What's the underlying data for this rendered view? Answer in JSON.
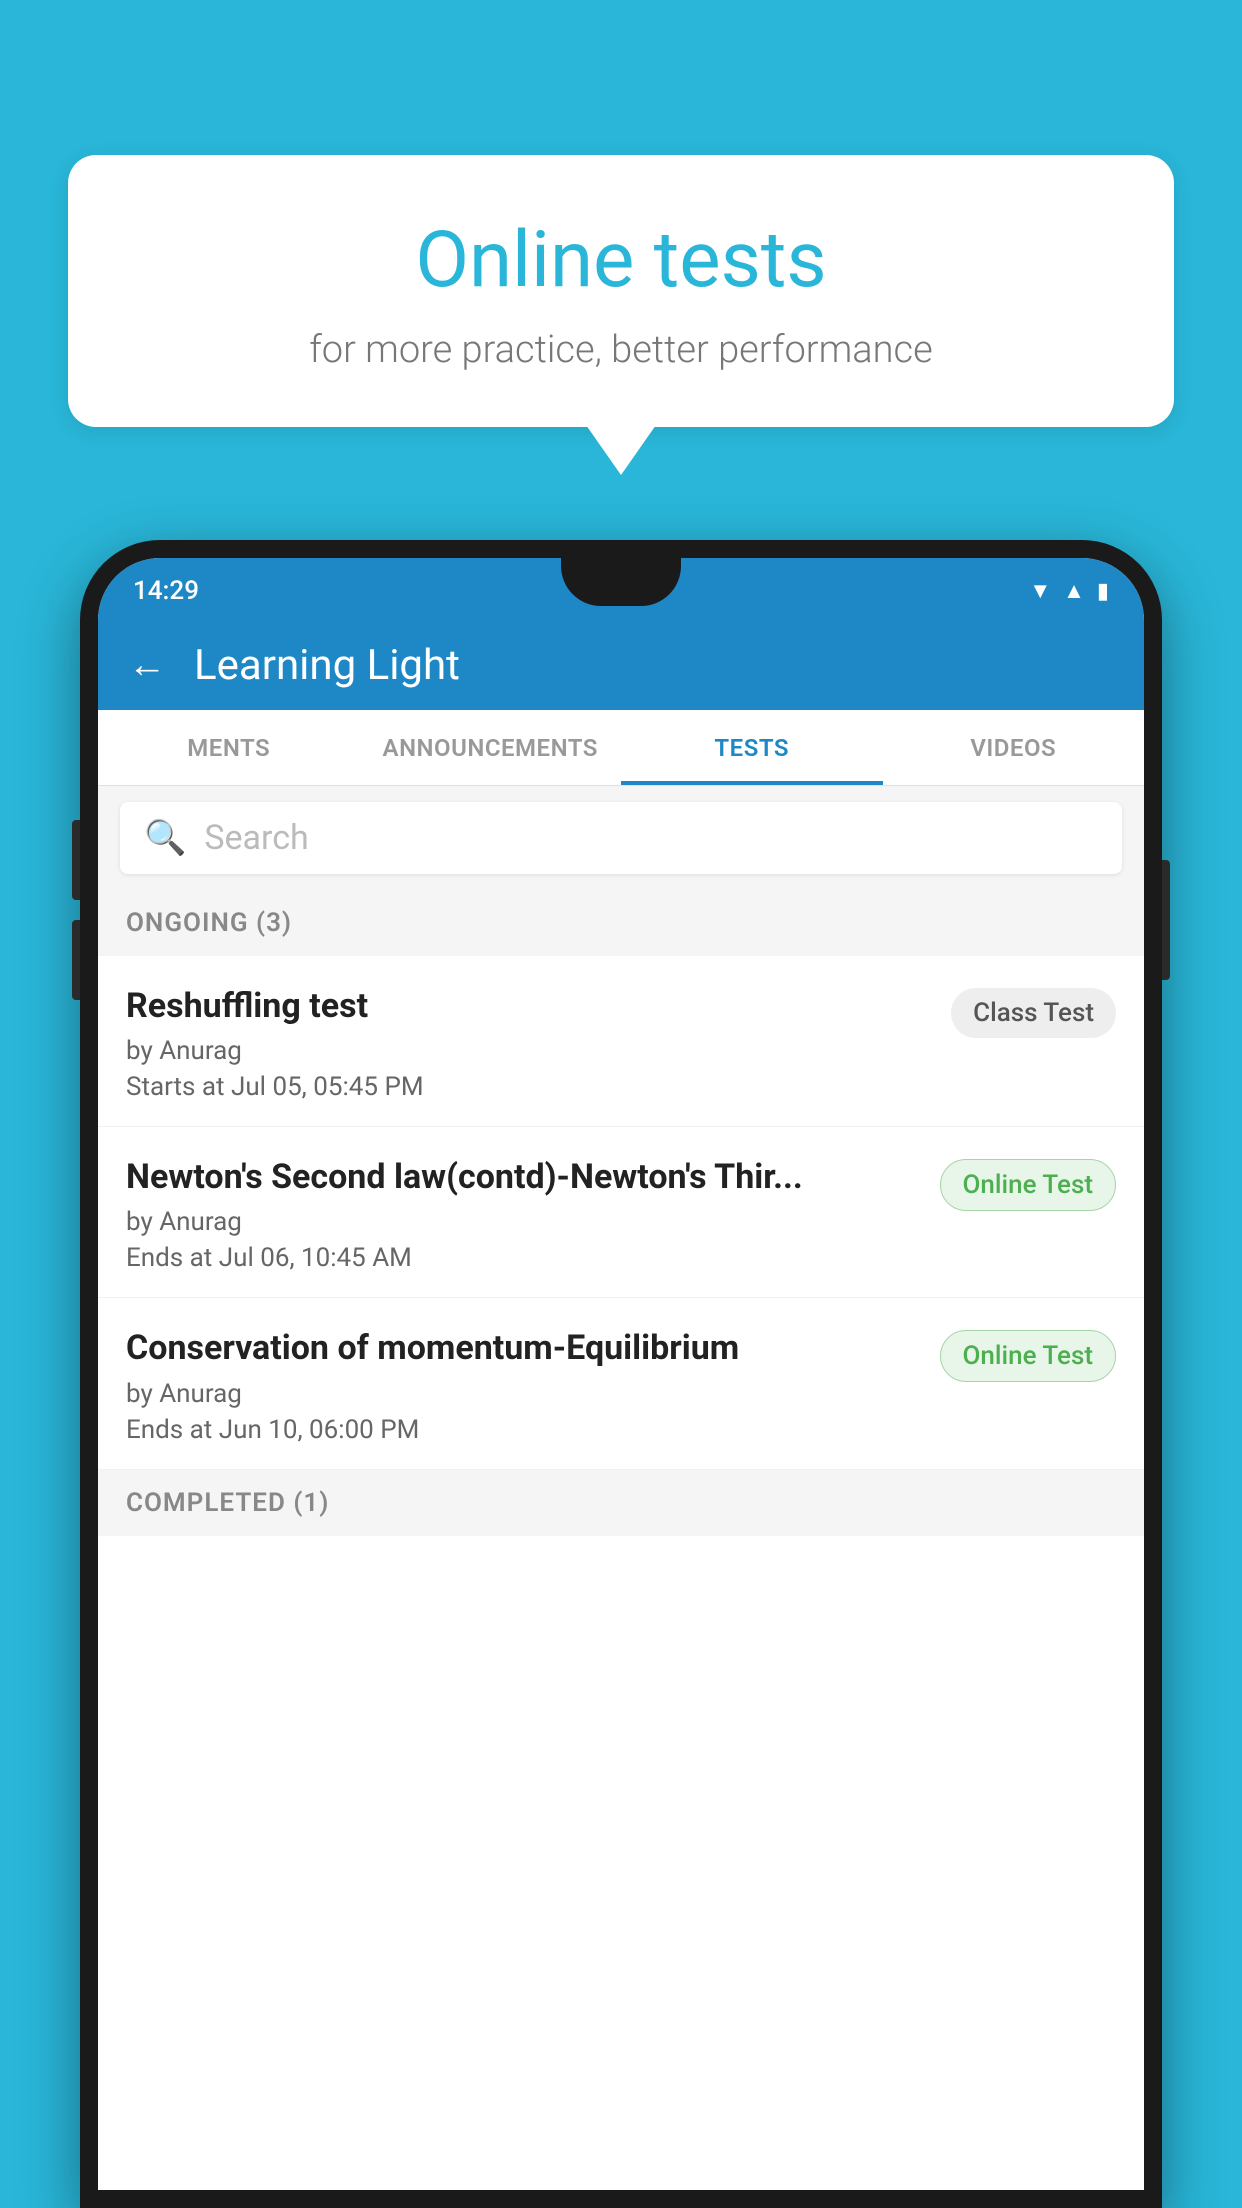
{
  "background": {
    "color": "#29b6d8"
  },
  "bubble": {
    "title": "Online tests",
    "subtitle": "for more practice, better performance"
  },
  "phone": {
    "status_bar": {
      "time": "14:29",
      "wifi_icon": "▼",
      "signal_icon": "▲",
      "battery_icon": "▮"
    },
    "app_bar": {
      "back_label": "←",
      "title": "Learning Light"
    },
    "tabs": [
      {
        "label": "MENTS",
        "active": false
      },
      {
        "label": "ANNOUNCEMENTS",
        "active": false
      },
      {
        "label": "TESTS",
        "active": true
      },
      {
        "label": "VIDEOS",
        "active": false
      }
    ],
    "search": {
      "placeholder": "Search"
    },
    "ongoing_section": {
      "label": "ONGOING (3)"
    },
    "tests": [
      {
        "name": "Reshuffling test",
        "author": "by Anurag",
        "date": "Starts at  Jul 05, 05:45 PM",
        "badge": "Class Test",
        "badge_type": "class"
      },
      {
        "name": "Newton's Second law(contd)-Newton's Thir...",
        "author": "by Anurag",
        "date": "Ends at  Jul 06, 10:45 AM",
        "badge": "Online Test",
        "badge_type": "online"
      },
      {
        "name": "Conservation of momentum-Equilibrium",
        "author": "by Anurag",
        "date": "Ends at  Jun 10, 06:00 PM",
        "badge": "Online Test",
        "badge_type": "online"
      }
    ],
    "completed_section": {
      "label": "COMPLETED (1)"
    }
  }
}
